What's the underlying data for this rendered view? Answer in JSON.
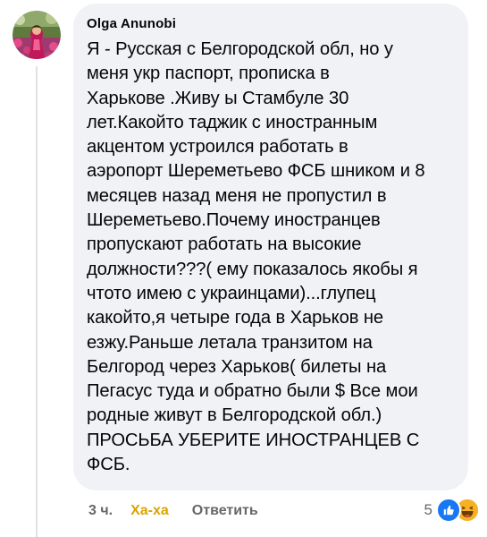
{
  "comment": {
    "author": "Olga Anunobi",
    "text": "Я - Русская с Белгородской обл, но у\nменя укр паспорт, прописка в\nХарькове .Живу ы Стамбуле 30\nлет.Какойто таджик с иностранным\nакцентом устроился работать в\nаэропорт Шереметьево ФСБ шником и 8\nмесяцев назад меня не пропустил в\nШереметьево.Почему иностранцев\nпропускают работать на высокие\nдолжности???( ему показалось якобы я\nчтото имею с украинцами)...глупец\nкакойто,я четыре года в Харьков не\nезжу.Раньше летала транзитом на\nБелгород через Харьков( билеты на\nПегасус туда и обратно были $ Все мои\nродные живут в Белгородской обл.)\nПРОСЬБА УБЕРИТЕ ИНОСТРАНЦЕВ С\nФСБ."
  },
  "actions": {
    "time": "3 ч.",
    "reaction_label": "Ха-ха",
    "reply_label": "Ответить"
  },
  "reactions": {
    "count": "5",
    "icons": [
      "like-icon",
      "haha-icon"
    ]
  },
  "colors": {
    "bubble_bg": "#f0f2f5",
    "text": "#050505",
    "secondary": "#65676b",
    "haha": "#d9a400",
    "like_blue": "#1877f2",
    "haha_yellow": "#f7b125"
  }
}
